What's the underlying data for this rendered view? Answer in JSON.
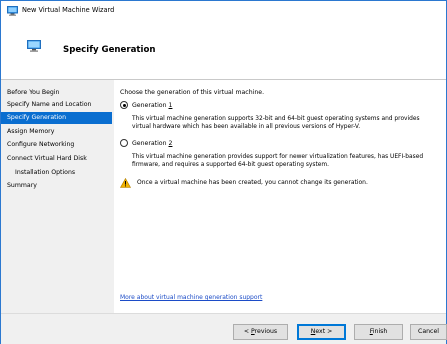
{
  "window": {
    "title": "New Virtual Machine Wizard"
  },
  "header": {
    "title": "Specify Generation"
  },
  "sidebar": {
    "items": [
      {
        "label": "Before You Begin",
        "selected": false,
        "sub": false
      },
      {
        "label": "Specify Name and Location",
        "selected": false,
        "sub": false
      },
      {
        "label": "Specify Generation",
        "selected": true,
        "sub": false
      },
      {
        "label": "Assign Memory",
        "selected": false,
        "sub": false
      },
      {
        "label": "Configure Networking",
        "selected": false,
        "sub": false
      },
      {
        "label": "Connect Virtual Hard Disk",
        "selected": false,
        "sub": false
      },
      {
        "label": "Installation Options",
        "selected": false,
        "sub": true
      },
      {
        "label": "Summary",
        "selected": false,
        "sub": false
      }
    ]
  },
  "content": {
    "intro": "Choose the generation of this virtual machine.",
    "options": [
      {
        "label_prefix": "Generation ",
        "label_key": "1",
        "checked": true,
        "desc_line1": "This virtual machine generation supports 32-bit and 64-bit guest operating systems and provides",
        "desc_line2": "virtual hardware which has been available in all previous versions of Hyper-V."
      },
      {
        "label_prefix": "Generation ",
        "label_key": "2",
        "checked": false,
        "desc_line1": "This virtual machine generation provides support for newer virtualization features, has UEFI-based",
        "desc_line2": "firmware, and requires a supported 64-bit guest operating system."
      }
    ],
    "warning": "Once a virtual machine has been created, you cannot change its generation.",
    "more_link": "More about virtual machine generation support"
  },
  "footer": {
    "previous": {
      "pre": "< ",
      "key": "P",
      "post": "revious"
    },
    "next": {
      "pre": "",
      "key": "N",
      "post": "ext >"
    },
    "finish": {
      "pre": "",
      "key": "F",
      "post": "inish"
    },
    "cancel": "Cancel"
  },
  "colors": {
    "accent": "#0a6ed0",
    "link": "#1c4cc7",
    "sidebar_bg": "#f0f0f0",
    "warning": "#f2b300"
  }
}
